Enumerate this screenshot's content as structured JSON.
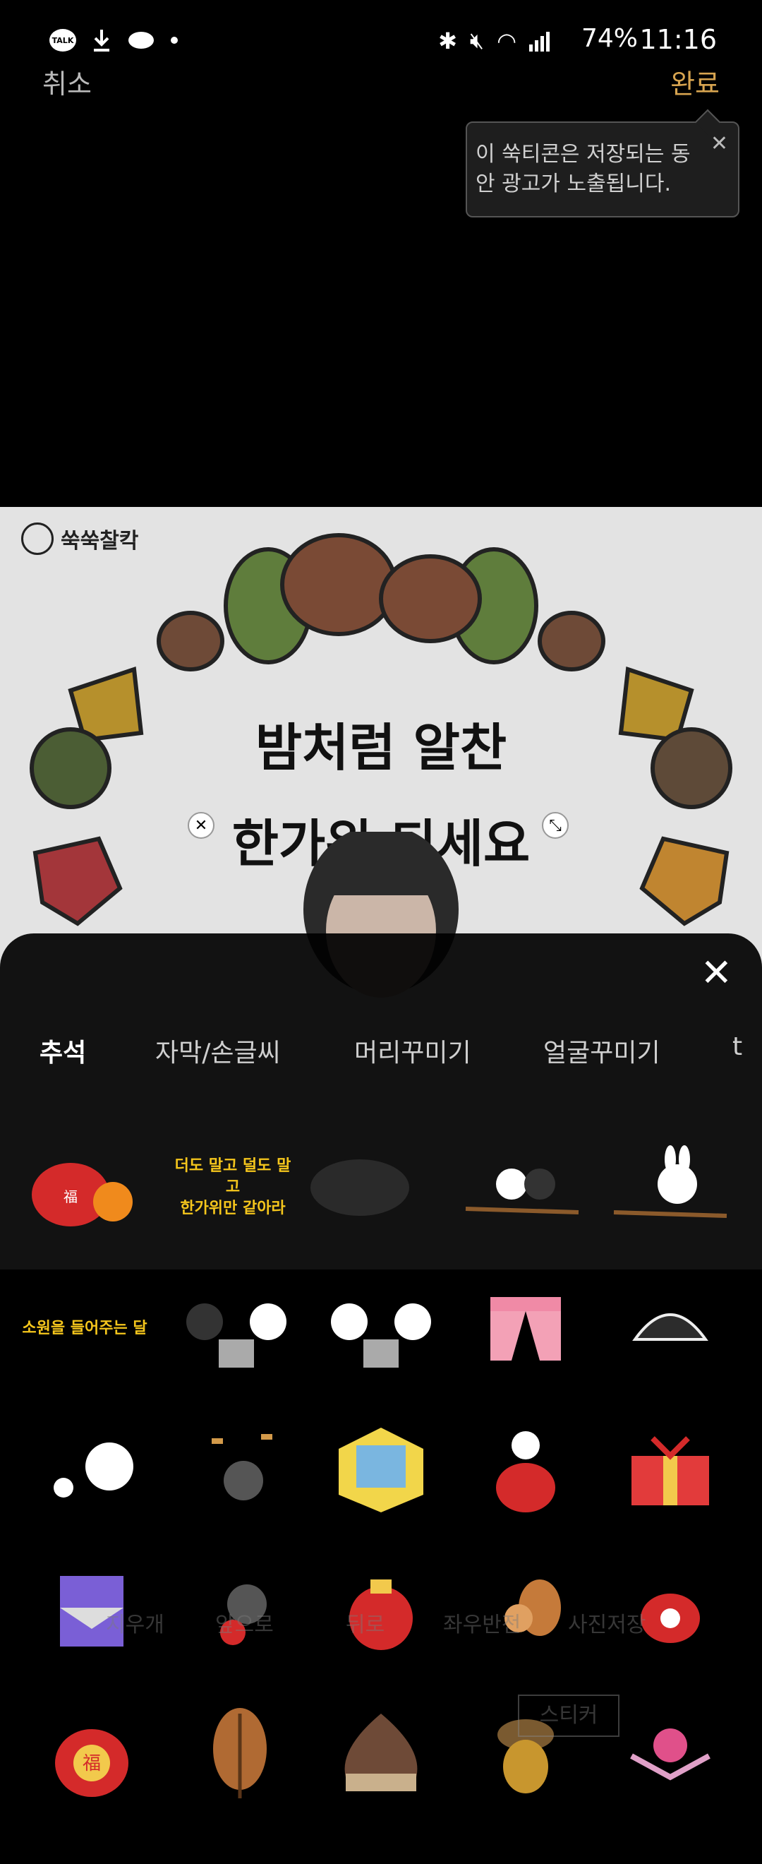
{
  "status_bar": {
    "left_icons": [
      "kakaotalk-icon",
      "download-icon",
      "cloud-icon",
      "dot"
    ],
    "right_icons": [
      "bluetooth-icon",
      "mute-icon",
      "wifi-icon",
      "signal-icon"
    ],
    "battery": "74%",
    "time": "11:16"
  },
  "actions": {
    "cancel": "취소",
    "done": "완료"
  },
  "tooltip": {
    "text": "이 쑥티콘은 저장되는 동안 광고가 노출됩니다."
  },
  "photo": {
    "brand": "쑥쑥찰칵",
    "headline_line1": "밤처럼 알찬",
    "headline_line2": "한가위 되세요"
  },
  "sheet": {
    "tabs": [
      "추석",
      "자막/손글씨",
      "머리꾸미기",
      "얼굴꾸미기",
      "t"
    ],
    "active_tab": "추석",
    "sticker_texts": {
      "hangawi": "더도 말고 덜도 말고\n한가위만 같아라",
      "wish_moon": "소원을 들어주는 달"
    }
  },
  "underlying_toolbar": {
    "labels": [
      "지우개",
      "앞으로",
      "뒤로",
      "좌우반전",
      "사진저장"
    ],
    "sticker_button": "스티커"
  },
  "colors": {
    "accent_done": "#d7a450",
    "sticker_text": "#f5c61c"
  }
}
